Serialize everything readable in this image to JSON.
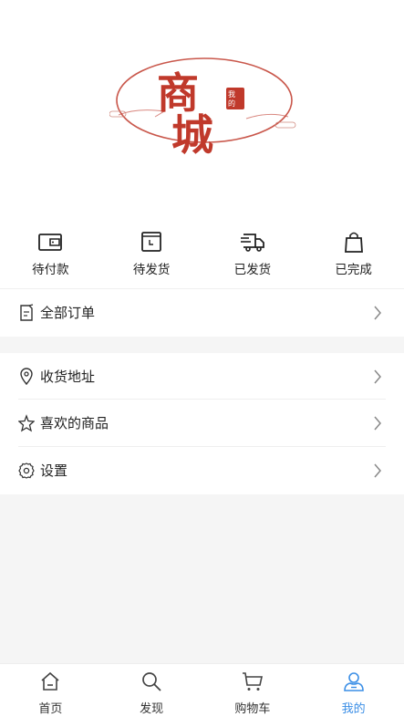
{
  "logo": {
    "main_chars": [
      "商",
      "城"
    ],
    "seal_text": "我的"
  },
  "order_status": [
    {
      "label": "待付款",
      "icon": "wallet-icon"
    },
    {
      "label": "待发货",
      "icon": "calendar-icon"
    },
    {
      "label": "已发货",
      "icon": "truck-icon"
    },
    {
      "label": "已完成",
      "icon": "bag-icon"
    }
  ],
  "menu": {
    "all_orders": {
      "label": "全部订单",
      "icon": "order-list-icon"
    },
    "address": {
      "label": "收货地址",
      "icon": "location-icon"
    },
    "favorites": {
      "label": "喜欢的商品",
      "icon": "star-icon"
    },
    "settings": {
      "label": "设置",
      "icon": "gear-icon"
    }
  },
  "bottom_nav": [
    {
      "label": "首页",
      "icon": "home-icon",
      "active": false
    },
    {
      "label": "发现",
      "icon": "search-icon",
      "active": false
    },
    {
      "label": "购物车",
      "icon": "cart-icon",
      "active": false
    },
    {
      "label": "我的",
      "icon": "user-icon",
      "active": true
    }
  ],
  "colors": {
    "accent": "#3a8ee6",
    "logo_red": "#c0392b",
    "background": "#f7f7f7"
  }
}
